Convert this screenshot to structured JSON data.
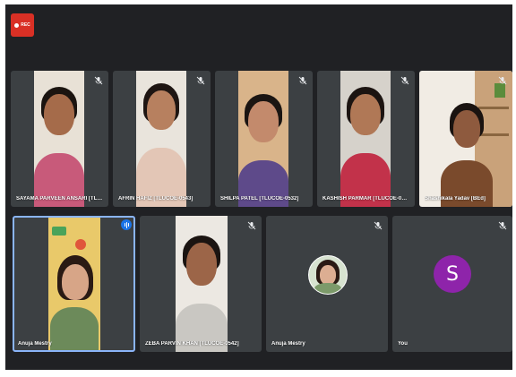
{
  "meeting": {
    "rec_label": "REC",
    "accent_color": "#1a73e8",
    "rec_color": "#d93025"
  },
  "participants": [
    {
      "name": "SAYAMA PARVEEN ANSARI [TLUCOE-...",
      "muted": true,
      "kind": "video"
    },
    {
      "name": "AFRIN HAFIZ [TLUCOE-0543]",
      "muted": true,
      "kind": "video"
    },
    {
      "name": "SHILPA PATEL [TLUCOE-0532]",
      "muted": true,
      "kind": "video"
    },
    {
      "name": "KASHISH PARMAR [TLUCOE-0535]",
      "muted": true,
      "kind": "video"
    },
    {
      "name": "Shashikala Yadav [BEd]",
      "muted": true,
      "kind": "video"
    },
    {
      "name": "Anuja Mestry",
      "muted": false,
      "speaking": true,
      "kind": "video"
    },
    {
      "name": "ZEBA PARVIN KHAN [TLUCOE-0542]",
      "muted": true,
      "kind": "video"
    },
    {
      "name": "Anuja Mestry",
      "muted": true,
      "kind": "avatar-photo"
    },
    {
      "name": "You",
      "muted": true,
      "kind": "avatar-letter",
      "avatar_letter": "S",
      "avatar_color": "#8e24aa"
    }
  ]
}
